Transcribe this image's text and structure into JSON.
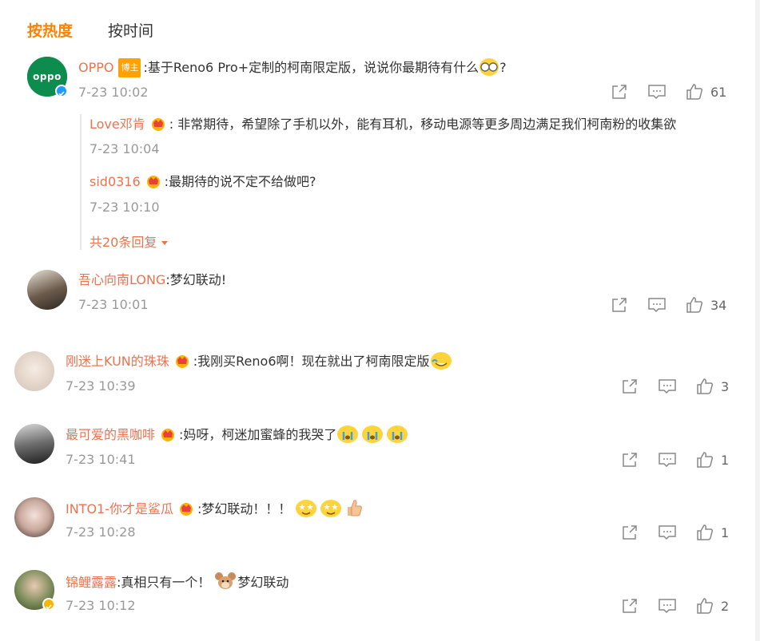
{
  "tabs": {
    "hot": "按热度",
    "time": "按时间"
  },
  "main_comment": {
    "user": "OPPO",
    "badge": "博主",
    "text": ":基于Reno6 Pro+定制的柯南限定版，说说你最期待有什么",
    "text_tail": "?",
    "time": "7-23 10:02",
    "likes": "61",
    "avatar_text": "oppo",
    "replies": [
      {
        "user": "Love邓肯",
        "text": ": 非常期待，希望除了手机以外，能有耳机，移动电源等更多周边满足我们柯南粉的收集欲",
        "time": "7-23 10:04"
      },
      {
        "user": "sid0316",
        "text": ":最期待的说不定不给做吧?",
        "time": "7-23 10:10"
      }
    ],
    "more_replies": "共20条回复"
  },
  "comments": [
    {
      "user": "吾心向南LONG",
      "text": ":梦幻联动!",
      "time": "7-23 10:01",
      "likes": "34"
    },
    {
      "user": "刚迷上KUN的珠珠",
      "text": ":我刚买Reno6啊！现在就出了柯南限定版",
      "time": "7-23 10:39",
      "likes": "3"
    },
    {
      "user": "最可爱的黑咖啡",
      "text": ":妈呀，柯迷加蜜蜂的我哭了",
      "time": "7-23 10:41",
      "likes": "1"
    },
    {
      "user": "INTO1-你才是鲨瓜",
      "text": ":梦幻联动！！！",
      "time": "7-23 10:28",
      "likes": "1"
    },
    {
      "user": "锦鲤露露",
      "text": ":真相只有一个！",
      "text2": "梦幻联动",
      "time": "7-23 10:12",
      "likes": "2"
    }
  ],
  "colors": {
    "accent": "#ff8200",
    "username": "#eb7350",
    "meta": "#999999",
    "verify_blue": "#1e9bff",
    "verify_gold": "#f5b800"
  },
  "icons": {
    "share": "share-icon",
    "comment": "comment-icon",
    "like": "like-icon",
    "crown": "crown-badge-icon",
    "dropdown": "caret-down-icon"
  }
}
